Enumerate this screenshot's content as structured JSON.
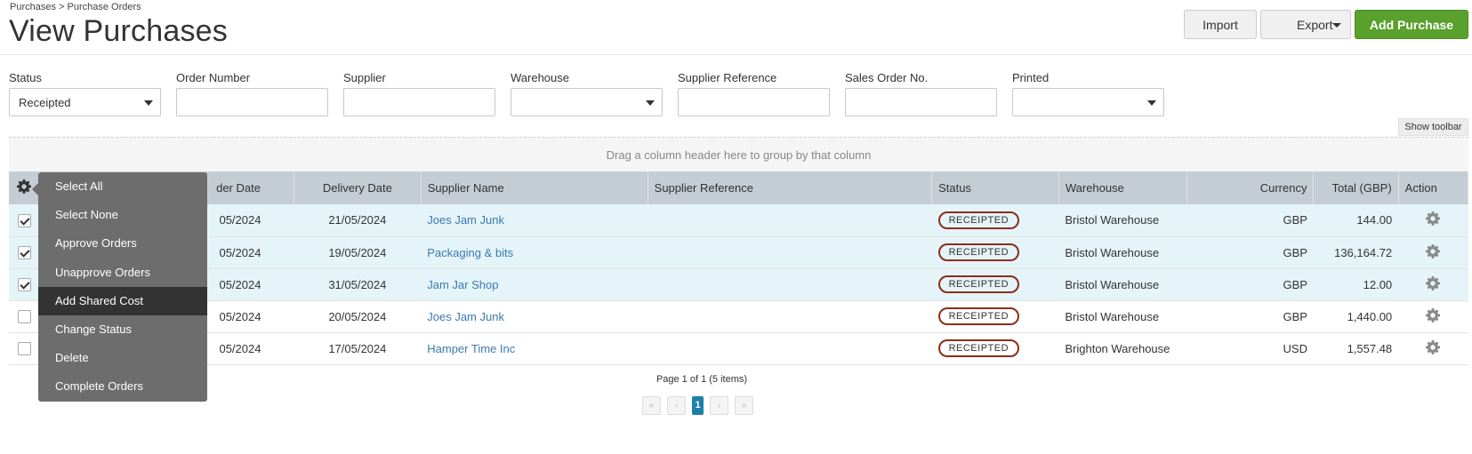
{
  "breadcrumb": "Purchases > Purchase Orders",
  "title": "View Purchases",
  "buttons": {
    "import": "Import",
    "export": "Export",
    "add": "Add Purchase"
  },
  "filters": {
    "status_label": "Status",
    "status_value": "Receipted",
    "order_number_label": "Order Number",
    "supplier_label": "Supplier",
    "warehouse_label": "Warehouse",
    "supplier_reference_label": "Supplier Reference",
    "sales_order_label": "Sales Order No.",
    "printed_label": "Printed"
  },
  "show_toolbar": "Show toolbar",
  "group_panel": "Drag a column header here to group by that column",
  "columns": {
    "order_date": "der Date",
    "delivery_date": "Delivery Date",
    "supplier_name": "Supplier Name",
    "supplier_reference": "Supplier Reference",
    "status": "Status",
    "warehouse": "Warehouse",
    "currency": "Currency",
    "total": "Total (GBP)",
    "action": "Action"
  },
  "rows": [
    {
      "checked": true,
      "order_date": "05/2024",
      "delivery_date": "21/05/2024",
      "supplier": "Joes Jam Junk",
      "supplier_ref": "",
      "status": "RECEIPTED",
      "warehouse": "Bristol Warehouse",
      "currency": "GBP",
      "total": "144.00"
    },
    {
      "checked": true,
      "order_date": "05/2024",
      "delivery_date": "19/05/2024",
      "supplier": "Packaging & bits",
      "supplier_ref": "",
      "status": "RECEIPTED",
      "warehouse": "Bristol Warehouse",
      "currency": "GBP",
      "total": "136,164.72"
    },
    {
      "checked": true,
      "order_date": "05/2024",
      "delivery_date": "31/05/2024",
      "supplier": "Jam Jar Shop",
      "supplier_ref": "",
      "status": "RECEIPTED",
      "warehouse": "Bristol Warehouse",
      "currency": "GBP",
      "total": "12.00"
    },
    {
      "checked": false,
      "order_date": "05/2024",
      "delivery_date": "20/05/2024",
      "supplier": "Joes Jam Junk",
      "supplier_ref": "",
      "status": "RECEIPTED",
      "warehouse": "Bristol Warehouse",
      "currency": "GBP",
      "total": "1,440.00"
    },
    {
      "checked": false,
      "order_date": "05/2024",
      "delivery_date": "17/05/2024",
      "supplier": "Hamper Time Inc",
      "supplier_ref": "",
      "status": "RECEIPTED",
      "warehouse": "Brighton Warehouse",
      "currency": "USD",
      "total": "1,557.48"
    }
  ],
  "menu": {
    "items": [
      "Select All",
      "Select None",
      "Approve Orders",
      "Unapprove Orders",
      "Add Shared Cost",
      "Change Status",
      "Delete",
      "Complete Orders"
    ],
    "highlighted": "Add Shared Cost"
  },
  "pager": {
    "info": "Page 1 of 1 (5 items)",
    "current": "1"
  },
  "colors": {
    "accent_green": "#5aa02c",
    "header_bg": "#c4ccd4",
    "selected_row": "#e4f4f9",
    "badge_border": "#8b2d1a",
    "link": "#3b7ab0",
    "pager_current": "#1e7fa8"
  },
  "icons": {
    "settings": "gear-icon",
    "row_action": "gear-icon"
  }
}
